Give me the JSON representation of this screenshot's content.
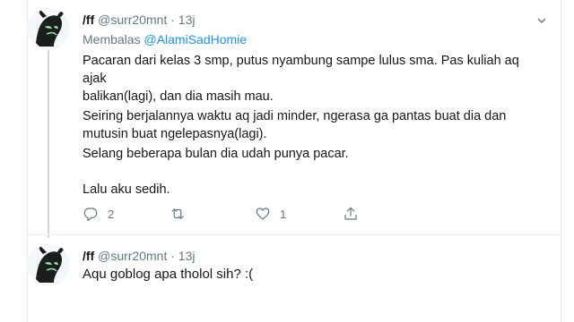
{
  "tweets": [
    {
      "display_name": "/ff",
      "handle": "@surr20mnt",
      "separator": "·",
      "time": "13j",
      "reply_prefix": "Membalas",
      "reply_mention": "@AlamiSadHomie",
      "paragraphs": [
        "Pacaran dari kelas 3 smp, putus nyambung sampe lulus sma. Pas kuliah aq ajak\nbalikan(lagi), dan dia masih mau.",
        "Seiring berjalannya waktu aq jadi minder, ngerasa ga pantas buat dia dan\nmutusin buat ngelepasnya(lagi).",
        "Selang beberapa bulan dia udah punya pacar.",
        "Lalu aku sedih."
      ],
      "actions": {
        "reply_count": "2",
        "retweet_count": "",
        "like_count": "1"
      }
    },
    {
      "display_name": "/ff",
      "handle": "@surr20mnt",
      "separator": "·",
      "time": "13j",
      "text": "Aqu goblog apa tholol sih? :("
    }
  ],
  "icons": {
    "reply": "reply-icon",
    "retweet": "retweet-icon",
    "like": "heart-icon",
    "share": "share-icon",
    "menu": "chevron-down-icon"
  },
  "colors": {
    "link": "#1b95e0",
    "muted": "#657786",
    "text": "#14171a",
    "border": "#e6ecf0"
  }
}
